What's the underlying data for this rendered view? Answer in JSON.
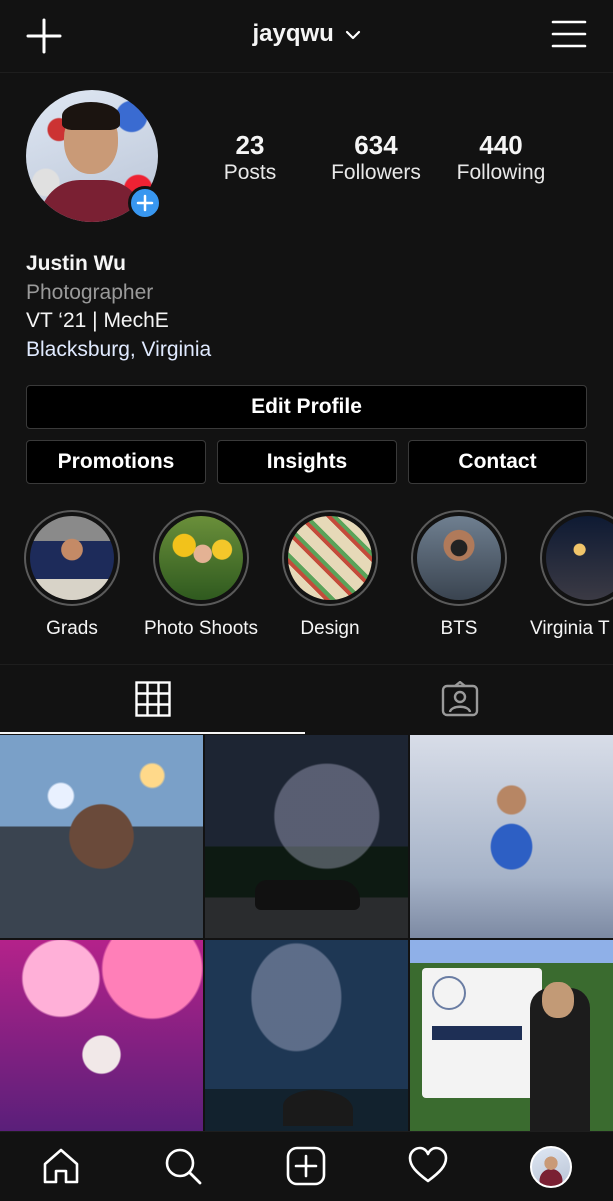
{
  "header": {
    "username": "jayqwu",
    "icons": [
      "plus-icon",
      "chevron-down-icon",
      "menu-icon"
    ]
  },
  "profile": {
    "stats": [
      {
        "value": "23",
        "label": "Posts"
      },
      {
        "value": "634",
        "label": "Followers"
      },
      {
        "value": "440",
        "label": "Following"
      }
    ],
    "name": "Justin Wu",
    "category": "Photographer",
    "bio_line": "VT ‘21 | MechE",
    "location": "Blacksburg, Virginia"
  },
  "buttons": {
    "edit_profile": "Edit Profile",
    "promotions": "Promotions",
    "insights": "Insights",
    "contact": "Contact"
  },
  "highlights": [
    {
      "label": "Grads"
    },
    {
      "label": "Photo Shoots"
    },
    {
      "label": "Design"
    },
    {
      "label": "BTS"
    },
    {
      "label": "Virginia T"
    }
  ],
  "tabs": {
    "active": "grid",
    "icons": [
      "grid-icon",
      "tagged-icon"
    ]
  },
  "bottom_nav": {
    "icons": [
      "home-icon",
      "search-icon",
      "new-post-icon",
      "activity-heart-icon",
      "profile-avatar"
    ]
  },
  "colors": {
    "background": "#121212",
    "accent": "#3897f0",
    "secondary_text": "#9a9a9a"
  }
}
